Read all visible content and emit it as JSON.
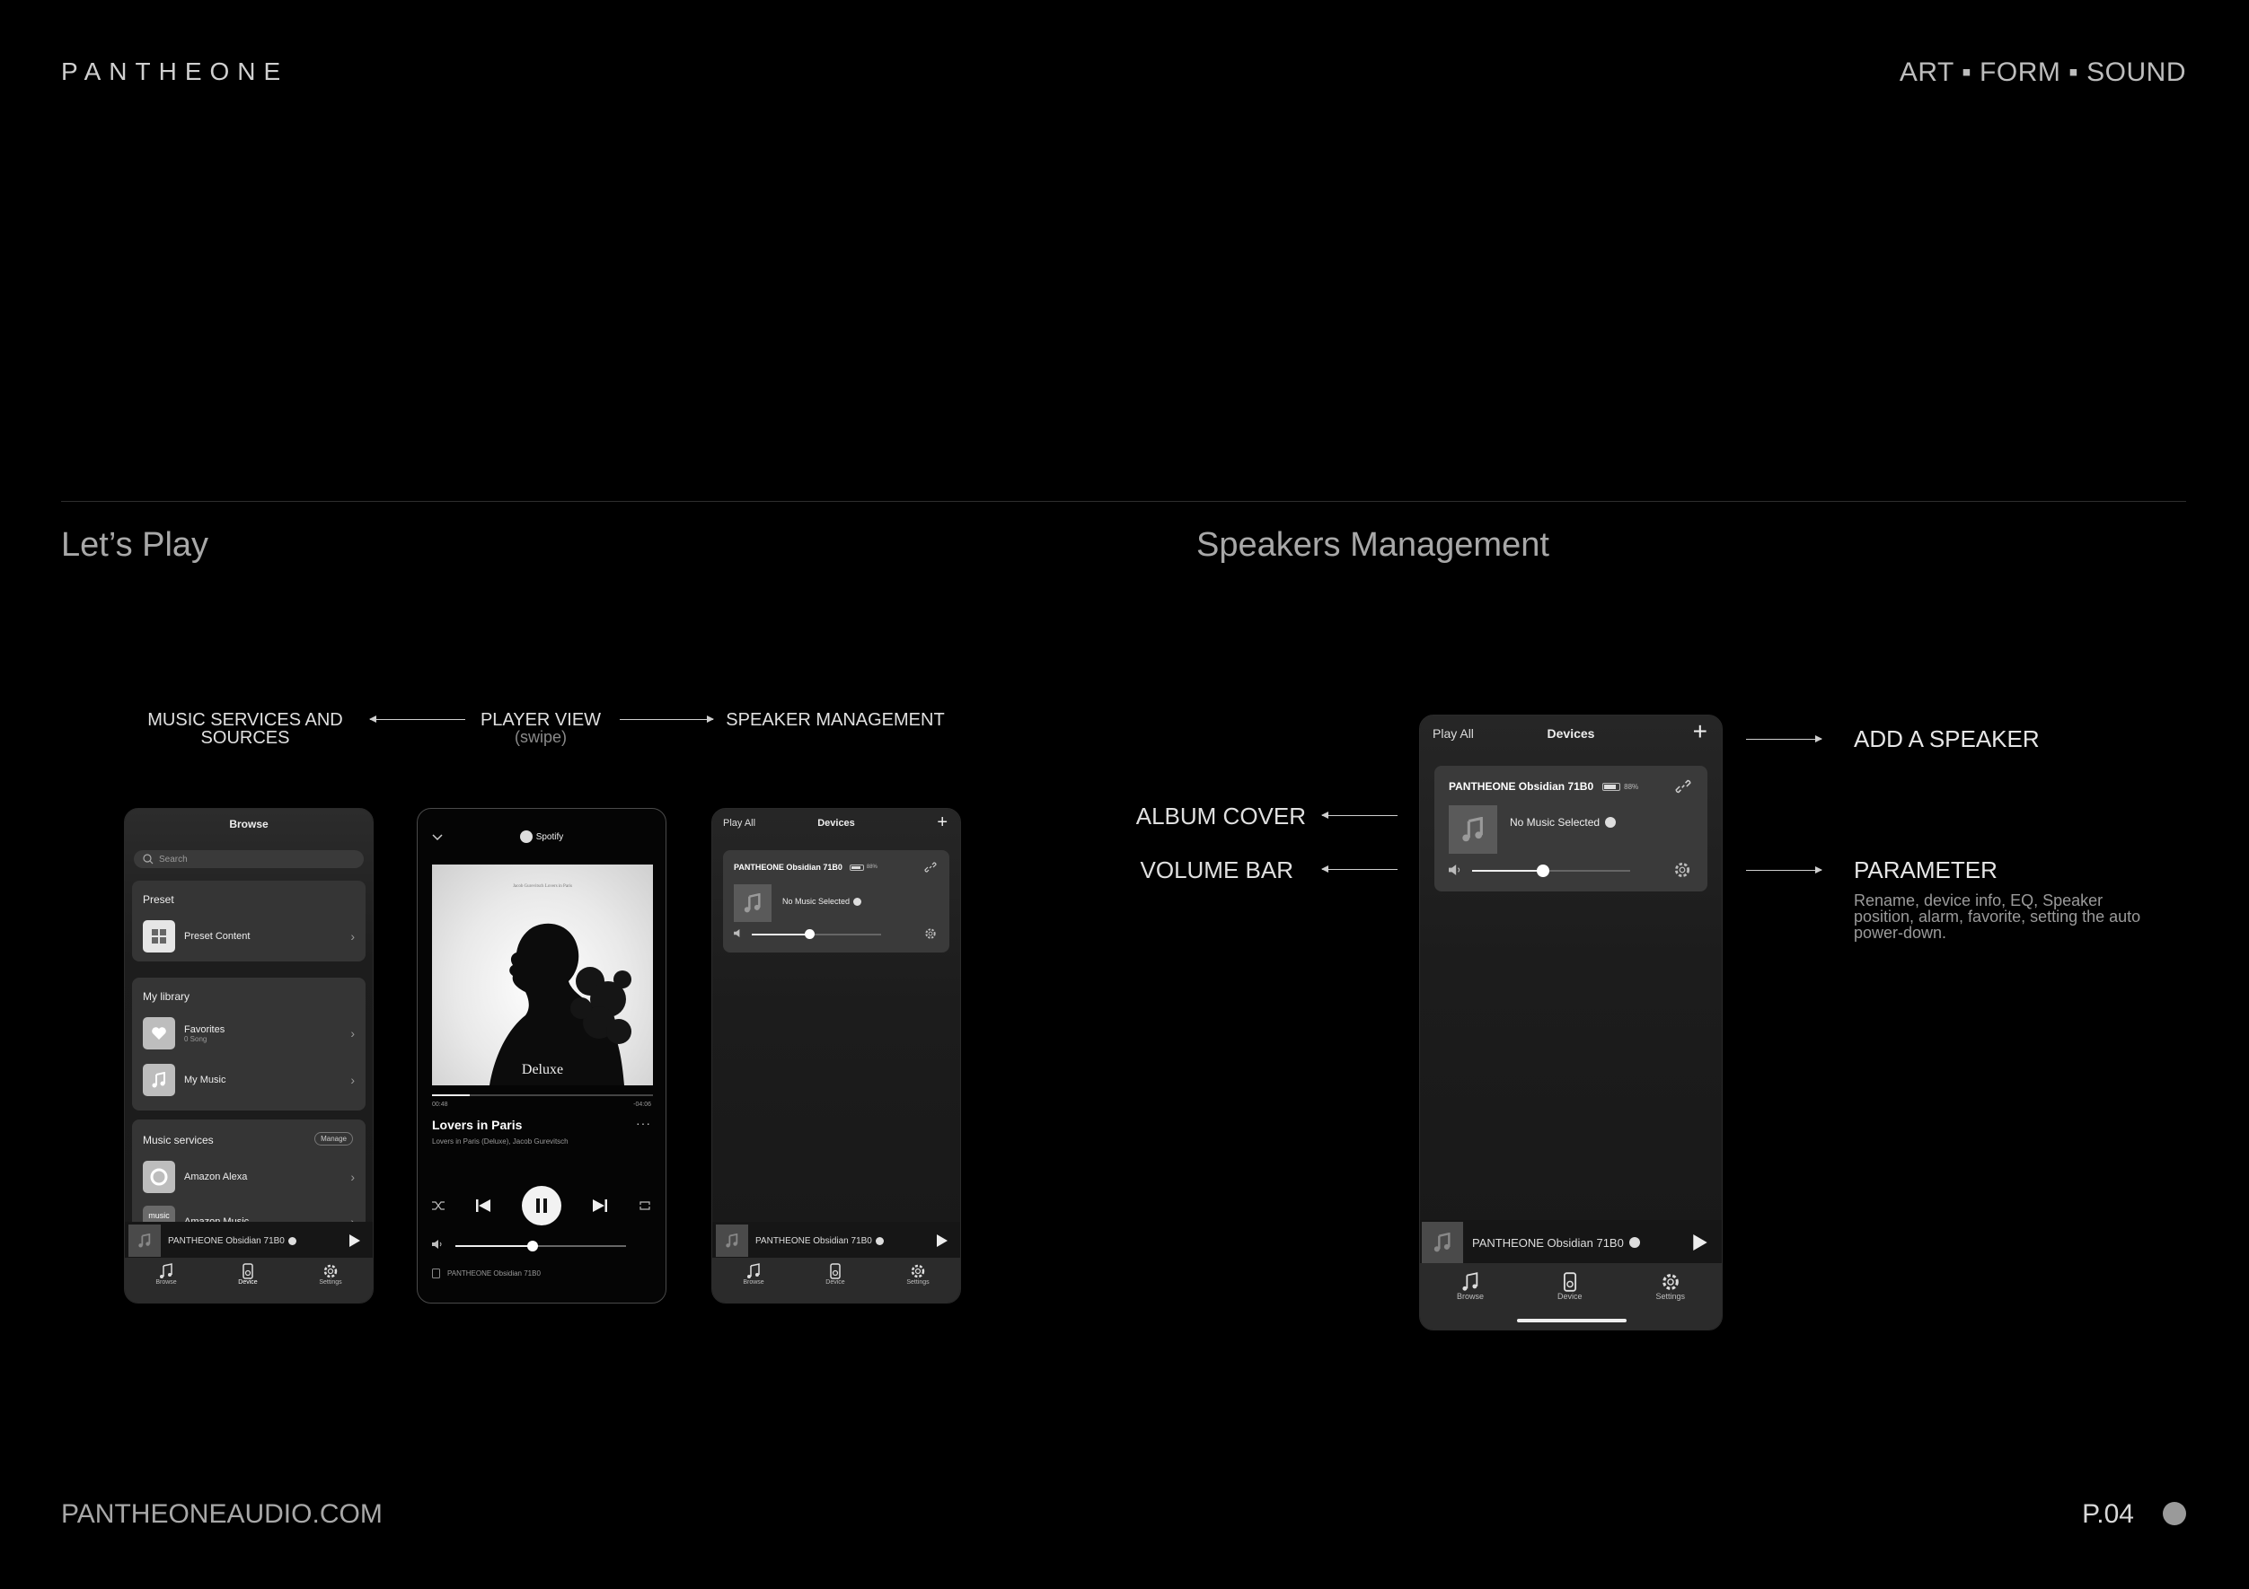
{
  "header": {
    "logo": "PANTHEONE",
    "tagline": "ART ▪ FORM ▪ SOUND"
  },
  "sections": {
    "left_title": "Let’s Play",
    "right_title": "Speakers Management"
  },
  "flow": {
    "music_services": "MUSIC SERVICES AND SOURCES",
    "player_view": "PLAYER VIEW",
    "player_view_sub": "(swipe)",
    "speaker_management": "SPEAKER MANAGEMENT"
  },
  "callouts": {
    "add_speaker": "ADD A SPEAKER",
    "album_cover": "ALBUM COVER",
    "volume_bar": "VOLUME BAR",
    "parameter": "PARAMETER",
    "parameter_desc": "Rename, device info, EQ, Speaker position, alarm, favorite, setting the auto power-down."
  },
  "browse_screen": {
    "title": "Browse",
    "search_placeholder": "Search",
    "preset_header": "Preset",
    "preset_item": "Preset Content",
    "library_header": "My library",
    "favorites": "Favorites",
    "favorites_sub": "0 Song",
    "my_music": "My Music",
    "services_header": "Music services",
    "manage": "Manage",
    "alexa": "Amazon Alexa",
    "amazon_music": "Amazon Music",
    "amazon_music_logo": "music"
  },
  "player_screen": {
    "source": "Spotify",
    "cover_top_text": "Jacob Gurevitsch Lovers in Paris",
    "cover_word": "Deluxe",
    "time_elapsed": "00:48",
    "time_remaining": "-04:06",
    "progress": 0.17,
    "track_title": "Lovers in Paris",
    "track_sub": "Lovers in Paris (Deluxe), Jacob Gurevitsch",
    "volume": 0.45,
    "device_name": "PANTHEONE Obsidian 71B0"
  },
  "devices_screen": {
    "play_all": "Play All",
    "title": "Devices",
    "device_name": "PANTHEONE Obsidian 71B0",
    "battery": "88%",
    "no_music": "No Music Selected",
    "volume": 0.45
  },
  "mini_player": {
    "name": "PANTHEONE Obsidian 71B0"
  },
  "tabs": {
    "browse": "Browse",
    "device": "Device",
    "settings": "Settings"
  },
  "footer": {
    "url": "PANTHEONEAUDIO.COM",
    "page": "P.04"
  }
}
